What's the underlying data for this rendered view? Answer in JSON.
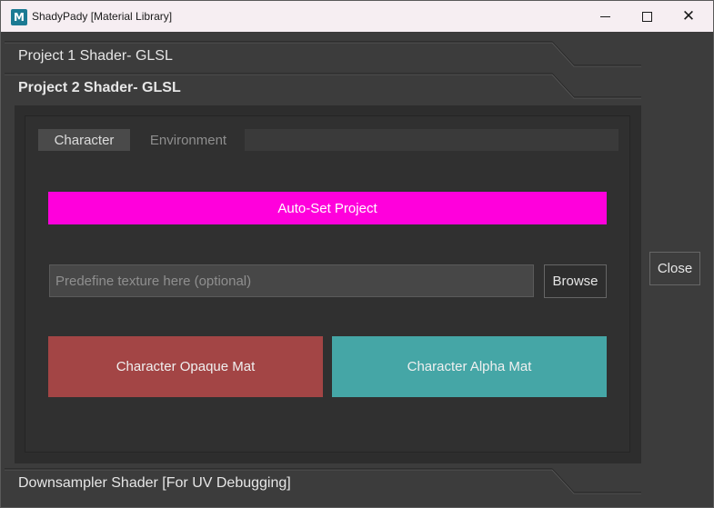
{
  "window": {
    "title": "ShadyPady [Material Library]",
    "app_icon_letter": "M",
    "minimize_glyph": "",
    "maximize_glyph": "",
    "close_glyph": "✕"
  },
  "frames": [
    {
      "label": "Project 1 Shader- GLSL",
      "expanded": false
    },
    {
      "label": "Project 2 Shader- GLSL",
      "expanded": true
    },
    {
      "label": "Downsampler Shader [For UV Debugging]",
      "expanded": false
    }
  ],
  "tabs": [
    {
      "label": "Character",
      "active": true
    },
    {
      "label": "Environment",
      "active": false
    }
  ],
  "actions": {
    "autoset_label": "Auto-Set Project",
    "texture_placeholder": "Predefine texture here (optional)",
    "texture_value": "",
    "browse_label": "Browse",
    "opaque_label": "Character Opaque Mat",
    "alpha_label": "Character Alpha Mat",
    "close_label": "Close"
  },
  "colors": {
    "autoset_bg": "#ff00dc",
    "opaque_bg": "#a34545",
    "alpha_bg": "#45a6a6",
    "window_bg": "#3c3c3c",
    "titlebar_bg": "#f6eef2"
  }
}
